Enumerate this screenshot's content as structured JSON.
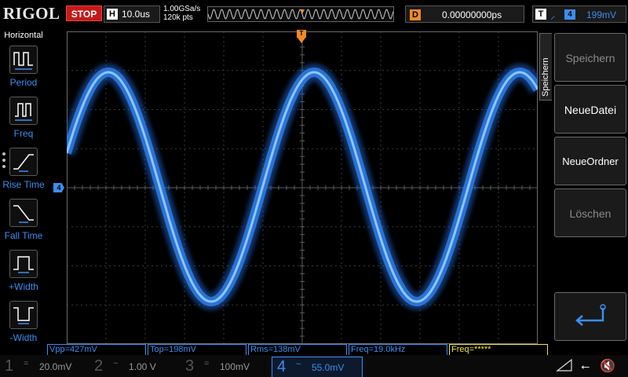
{
  "topbar": {
    "brand": "RIGOL",
    "run_state": "STOP",
    "horizontal_letter": "H",
    "timebase": "10.0us",
    "sample_rate": "1.00GSa/s",
    "memory_depth": "120k pts",
    "delay_letter": "D",
    "delay_value": "0.00000000ps",
    "trigger_letter": "T",
    "trigger_source": "4",
    "trigger_level": "199mV"
  },
  "left_menu": {
    "title": "Horizontal",
    "items": [
      {
        "label": "Period",
        "icon": "period-icon"
      },
      {
        "label": "Freq",
        "icon": "freq-icon"
      },
      {
        "label": "Rise Time",
        "icon": "rise-time-icon"
      },
      {
        "label": "Fall Time",
        "icon": "fall-time-icon"
      },
      {
        "label": "+Width",
        "icon": "plus-width-icon"
      },
      {
        "label": "-Width",
        "icon": "minus-width-icon"
      }
    ]
  },
  "grid": {
    "channel_marker": "4",
    "trigger_marker": "T"
  },
  "right_menu": {
    "tab_label": "Speichern",
    "buttons": [
      {
        "label": "Speichern",
        "enabled": false
      },
      {
        "label": "NeueDatei",
        "enabled": true
      },
      {
        "label": "NeueOrdner",
        "enabled": true
      },
      {
        "label": "Löschen",
        "enabled": false
      },
      {
        "label": "",
        "icon": "return-icon",
        "enabled": true
      }
    ]
  },
  "measurements": [
    {
      "text": "Vpp=427mV",
      "color": "#3b8ef0"
    },
    {
      "text": "Top=198mV",
      "color": "#3b8ef0"
    },
    {
      "text": "Rms=138mV",
      "color": "#3b8ef0"
    },
    {
      "text": "Freq=19.0kHz",
      "color": "#3b8ef0"
    },
    {
      "text": "Freq=*****",
      "color": "#f2e34a"
    }
  ],
  "channels": [
    {
      "num": "1",
      "coupling": "=",
      "scale": "20.0mV",
      "active": false
    },
    {
      "num": "2",
      "coupling": "~",
      "scale": "1.00 V",
      "active": false
    },
    {
      "num": "3",
      "coupling": "=",
      "scale": "100mV",
      "active": false
    },
    {
      "num": "4",
      "coupling": "~",
      "scale": "55.0mV",
      "active": true
    }
  ],
  "status_icons": [
    "network-icon",
    "usb-icon",
    "speaker-muted-icon"
  ],
  "colors": {
    "ch4": "#3b8ef0",
    "trigger": "#f08a24",
    "stop": "#c31a1a"
  }
}
